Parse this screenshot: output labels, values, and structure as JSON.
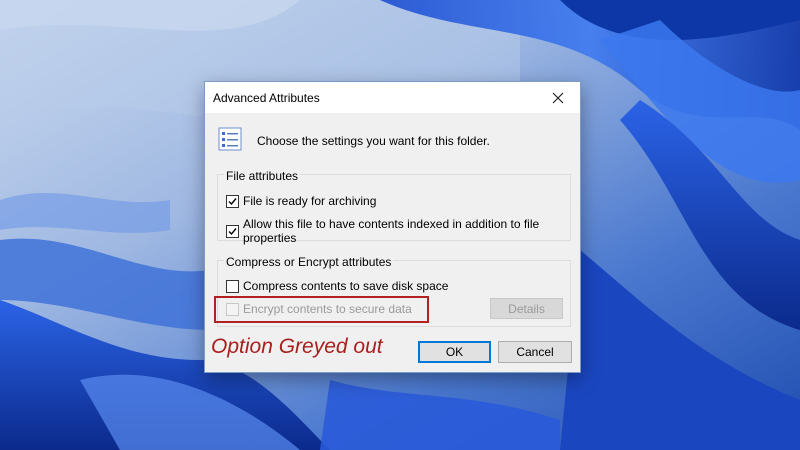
{
  "dialog": {
    "title": "Advanced Attributes",
    "header_text": "Choose the settings you want for this folder.",
    "file_attributes": {
      "title": "File attributes",
      "items": [
        {
          "label": "File is ready for archiving",
          "checked": true
        },
        {
          "label": "Allow this file to have contents indexed in addition to file properties",
          "checked": true
        }
      ]
    },
    "compress_encrypt": {
      "title": "Compress or Encrypt attributes",
      "compress": {
        "label": "Compress contents to save disk space",
        "checked": false
      },
      "encrypt": {
        "label": "Encrypt contents to secure data",
        "checked": false,
        "disabled": true
      },
      "details_label": "Details"
    },
    "ok_label": "OK",
    "cancel_label": "Cancel"
  },
  "annotation": {
    "text": "Option Greyed out",
    "color": "#a8201e"
  },
  "colors": {
    "accent": "#0078d7",
    "highlight": "#b32020"
  }
}
